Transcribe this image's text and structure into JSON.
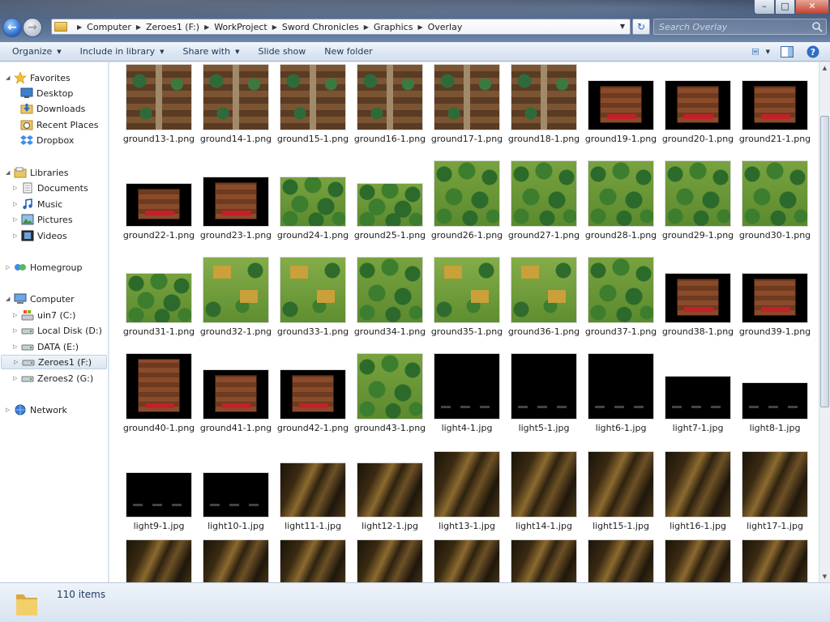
{
  "window": {
    "minimize_label": "–",
    "maximize_label": "□",
    "close_label": "✕"
  },
  "address": {
    "crumbs": [
      "Computer",
      "Zeroes1 (F:)",
      "WorkProject",
      "Sword Chronicles",
      "Graphics",
      "Overlay"
    ]
  },
  "search": {
    "placeholder": "Search Overlay"
  },
  "toolbar": {
    "organize": "Organize",
    "include_in_library": "Include in library",
    "share_with": "Share with",
    "slide_show": "Slide show",
    "new_folder": "New folder"
  },
  "nav": {
    "favorites": "Favorites",
    "desktop": "Desktop",
    "downloads": "Downloads",
    "recent_places": "Recent Places",
    "dropbox": "Dropbox",
    "libraries": "Libraries",
    "documents": "Documents",
    "music": "Music",
    "pictures": "Pictures",
    "videos": "Videos",
    "homegroup": "Homegroup",
    "computer": "Computer",
    "drive_c": "uin7 (C:)",
    "drive_d": "Local Disk (D:)",
    "drive_e": "DATA (E:)",
    "drive_f": "Zeroes1 (F:)",
    "drive_g": "Zeroes2 (G:)",
    "network": "Network"
  },
  "files": [
    {
      "name": "ground13-1.png",
      "kind": "town"
    },
    {
      "name": "ground14-1.png",
      "kind": "town"
    },
    {
      "name": "ground15-1.png",
      "kind": "town"
    },
    {
      "name": "ground16-1.png",
      "kind": "town"
    },
    {
      "name": "ground17-1.png",
      "kind": "town"
    },
    {
      "name": "ground18-1.png",
      "kind": "town"
    },
    {
      "name": "ground19-1.png",
      "kind": "interior"
    },
    {
      "name": "ground20-1.png",
      "kind": "interior"
    },
    {
      "name": "ground21-1.png",
      "kind": "interior"
    },
    {
      "name": "ground22-1.png",
      "kind": "interior"
    },
    {
      "name": "ground23-1.png",
      "kind": "interior"
    },
    {
      "name": "ground24-1.png",
      "kind": "forest"
    },
    {
      "name": "ground25-1.png",
      "kind": "forest"
    },
    {
      "name": "ground26-1.png",
      "kind": "forest"
    },
    {
      "name": "ground27-1.png",
      "kind": "forest"
    },
    {
      "name": "ground28-1.png",
      "kind": "forest"
    },
    {
      "name": "ground29-1.png",
      "kind": "forest"
    },
    {
      "name": "ground30-1.png",
      "kind": "forest"
    },
    {
      "name": "ground31-1.png",
      "kind": "forest"
    },
    {
      "name": "ground32-1.png",
      "kind": "village"
    },
    {
      "name": "ground33-1.png",
      "kind": "village"
    },
    {
      "name": "ground34-1.png",
      "kind": "forest"
    },
    {
      "name": "ground35-1.png",
      "kind": "village"
    },
    {
      "name": "ground36-1.png",
      "kind": "village"
    },
    {
      "name": "ground37-1.png",
      "kind": "forest"
    },
    {
      "name": "ground38-1.png",
      "kind": "interior"
    },
    {
      "name": "ground39-1.png",
      "kind": "interior"
    },
    {
      "name": "ground40-1.png",
      "kind": "interior"
    },
    {
      "name": "ground41-1.png",
      "kind": "interior"
    },
    {
      "name": "ground42-1.png",
      "kind": "interior"
    },
    {
      "name": "ground43-1.png",
      "kind": "forest"
    },
    {
      "name": "light4-1.jpg",
      "kind": "black"
    },
    {
      "name": "light5-1.jpg",
      "kind": "black"
    },
    {
      "name": "light6-1.jpg",
      "kind": "black"
    },
    {
      "name": "light7-1.jpg",
      "kind": "black"
    },
    {
      "name": "light8-1.jpg",
      "kind": "black"
    },
    {
      "name": "light9-1.jpg",
      "kind": "black"
    },
    {
      "name": "light10-1.jpg",
      "kind": "black"
    },
    {
      "name": "light11-1.jpg",
      "kind": "ray"
    },
    {
      "name": "light12-1.jpg",
      "kind": "ray"
    },
    {
      "name": "light13-1.jpg",
      "kind": "ray"
    },
    {
      "name": "light14-1.jpg",
      "kind": "ray"
    },
    {
      "name": "light15-1.jpg",
      "kind": "ray"
    },
    {
      "name": "light16-1.jpg",
      "kind": "ray"
    },
    {
      "name": "light17-1.jpg",
      "kind": "ray"
    },
    {
      "name": "",
      "kind": "ray"
    },
    {
      "name": "",
      "kind": "ray"
    },
    {
      "name": "",
      "kind": "ray"
    },
    {
      "name": "",
      "kind": "ray"
    },
    {
      "name": "",
      "kind": "ray"
    },
    {
      "name": "",
      "kind": "ray"
    },
    {
      "name": "",
      "kind": "ray"
    },
    {
      "name": "",
      "kind": "ray"
    },
    {
      "name": "",
      "kind": "ray"
    }
  ],
  "status": {
    "item_count": "110 items"
  }
}
